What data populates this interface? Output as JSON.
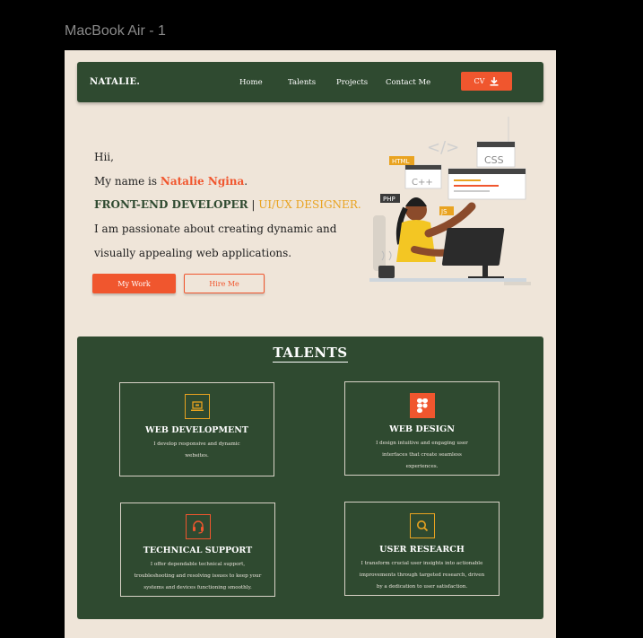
{
  "frame": {
    "label": "MacBook Air - 1"
  },
  "nav": {
    "logo": "NATALIE.",
    "links": [
      "Home",
      "Talents",
      "Projects",
      "Contact Me"
    ],
    "cv_label": "CV"
  },
  "hero": {
    "greeting": "Hii,",
    "name_prefix": "My name is ",
    "name": "Natalie Ngina",
    "name_suffix": ".",
    "role_1": "FRONT-END DEVELOPER",
    "role_sep": " | ",
    "role_2": "UI/UX DESIGNER.",
    "tagline_1": "I am passionate about creating dynamic and",
    "tagline_2": "visually appealing web applications.",
    "btn_work": "My Work",
    "btn_hire": "Hire Me",
    "illustration_labels": [
      "HTML",
      "C++",
      "CSS",
      "PHP",
      "JS"
    ]
  },
  "talents": {
    "title": "TALENTS",
    "cards": [
      {
        "icon": "laptop-icon",
        "title": "WEB DEVELOPMENT",
        "desc": [
          "I develop responsive and dynamic",
          "websites."
        ]
      },
      {
        "icon": "figma-icon",
        "title": "WEB DESIGN",
        "desc": [
          "I design intuitive and engaging user",
          "interfaces that create seamless",
          "experiences."
        ]
      },
      {
        "icon": "headset-icon",
        "title": "TECHNICAL SUPPORT",
        "desc": [
          "I offer dependable technical support,",
          "troubleshooting and resolving issues to keep your",
          "systems and devices functioning smoothly."
        ]
      },
      {
        "icon": "search-icon",
        "title": "USER RESEARCH",
        "desc": [
          "I transform crucial user insights into actionable",
          "improvements through targeted research, driven",
          "by a dedication to user satisfaction."
        ]
      }
    ]
  },
  "colors": {
    "primary_green": "#2f4a30",
    "accent_orange": "#f0562e",
    "accent_yellow": "#e9a320",
    "background": "#efe5d9"
  }
}
